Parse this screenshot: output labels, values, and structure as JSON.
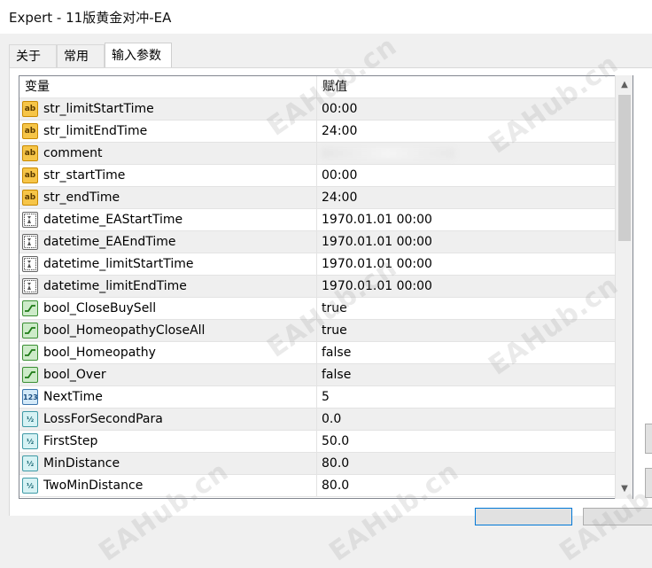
{
  "window": {
    "title": "Expert - 11版黄金对冲-EA"
  },
  "tabs": [
    {
      "label": "关于",
      "active": false
    },
    {
      "label": "常用",
      "active": false
    },
    {
      "label": "输入参数",
      "active": true
    }
  ],
  "table": {
    "columns": {
      "variable": "变量",
      "value": "赋值"
    },
    "rows": [
      {
        "type": "string",
        "name": "str_limitStartTime",
        "value": "00:00"
      },
      {
        "type": "string",
        "name": "str_limitEndTime",
        "value": "24:00"
      },
      {
        "type": "string",
        "name": "comment",
        "value": "",
        "blurred": true
      },
      {
        "type": "string",
        "name": "str_startTime",
        "value": "00:00"
      },
      {
        "type": "string",
        "name": "str_endTime",
        "value": "24:00"
      },
      {
        "type": "datetime",
        "name": "datetime_EAStartTime",
        "value": "1970.01.01 00:00"
      },
      {
        "type": "datetime",
        "name": "datetime_EAEndTime",
        "value": "1970.01.01 00:00"
      },
      {
        "type": "datetime",
        "name": "datetime_limitStartTime",
        "value": "1970.01.01 00:00"
      },
      {
        "type": "datetime",
        "name": "datetime_limitEndTime",
        "value": "1970.01.01 00:00"
      },
      {
        "type": "bool",
        "name": "bool_CloseBuySell",
        "value": "true"
      },
      {
        "type": "bool",
        "name": "bool_HomeopathyCloseAll",
        "value": "true"
      },
      {
        "type": "bool",
        "name": "bool_Homeopathy",
        "value": "false"
      },
      {
        "type": "bool",
        "name": "bool_Over",
        "value": "false"
      },
      {
        "type": "int",
        "name": "NextTime",
        "value": "5"
      },
      {
        "type": "double",
        "name": "LossForSecondPara",
        "value": "0.0"
      },
      {
        "type": "double",
        "name": "FirstStep",
        "value": "50.0"
      },
      {
        "type": "double",
        "name": "MinDistance",
        "value": "80.0"
      },
      {
        "type": "double",
        "name": "TwoMinDistance",
        "value": "80.0"
      }
    ]
  },
  "icons": {
    "string": "ab",
    "int": "123",
    "double": "½"
  },
  "watermark": "EAHub.cn"
}
